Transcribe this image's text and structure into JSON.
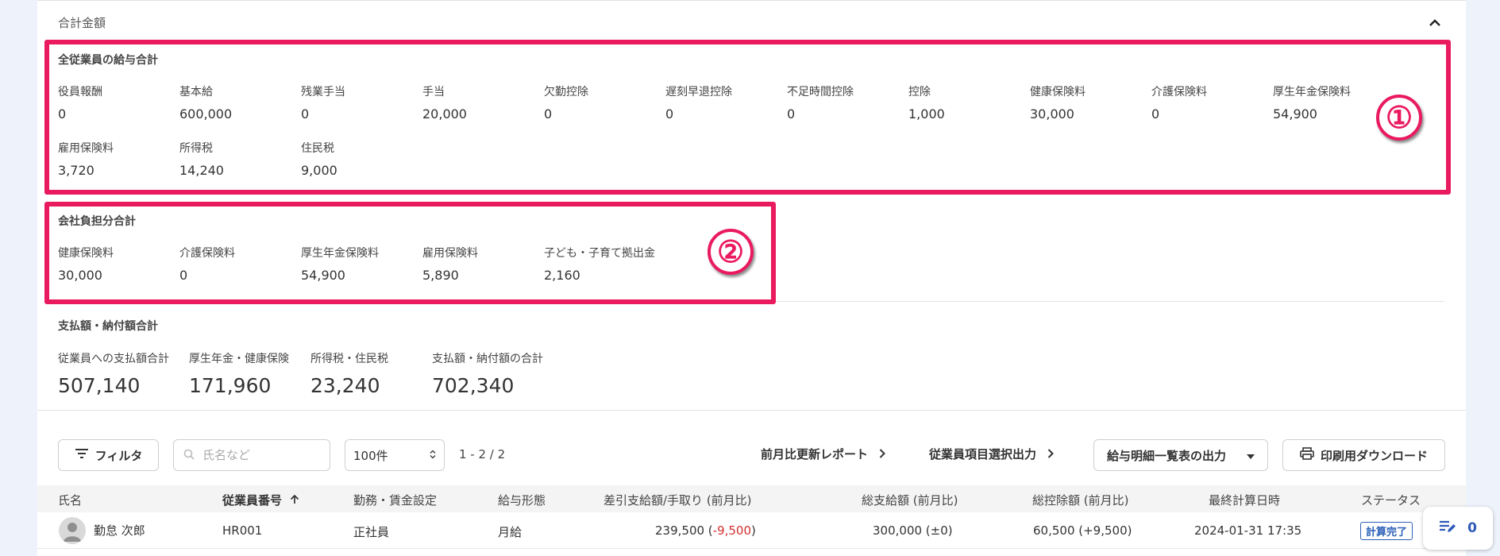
{
  "summary": {
    "header_title": "合計金額",
    "employee_total": {
      "title": "全従業員の給与合計",
      "items": [
        {
          "label": "役員報酬",
          "value": "0"
        },
        {
          "label": "基本給",
          "value": "600,000"
        },
        {
          "label": "残業手当",
          "value": "0"
        },
        {
          "label": "手当",
          "value": "20,000"
        },
        {
          "label": "欠勤控除",
          "value": "0"
        },
        {
          "label": "遅刻早退控除",
          "value": "0"
        },
        {
          "label": "不足時間控除",
          "value": "0"
        },
        {
          "label": "控除",
          "value": "1,000"
        },
        {
          "label": "健康保険料",
          "value": "30,000"
        },
        {
          "label": "介護保険料",
          "value": "0"
        },
        {
          "label": "厚生年金保険料",
          "value": "54,900"
        },
        {
          "label": "雇用保険料",
          "value": "3,720"
        },
        {
          "label": "所得税",
          "value": "14,240"
        },
        {
          "label": "住民税",
          "value": "9,000"
        }
      ]
    },
    "company_total": {
      "title": "会社負担分合計",
      "items": [
        {
          "label": "健康保険料",
          "value": "30,000"
        },
        {
          "label": "介護保険料",
          "value": "0"
        },
        {
          "label": "厚生年金保険料",
          "value": "54,900"
        },
        {
          "label": "雇用保険料",
          "value": "5,890"
        },
        {
          "label": "子ども・子育て拠出金",
          "value": "2,160"
        }
      ]
    },
    "payment_total": {
      "title": "支払額・納付額合計",
      "items": [
        {
          "label": "従業員への支払額合計",
          "value": "507,140"
        },
        {
          "label": "厚生年金・健康保険",
          "value": "171,960"
        },
        {
          "label": "所得税・住民税",
          "value": "23,240"
        },
        {
          "label": "支払額・納付額の合計",
          "value": "702,340"
        }
      ]
    }
  },
  "annotations": {
    "first": "①",
    "second": "②"
  },
  "toolbar": {
    "filter_label": "フィルタ",
    "search_placeholder": "氏名など",
    "per_page": "100件",
    "paging": "1 - 2 / 2",
    "report_link": "前月比更新レポート",
    "item_export_link": "従業員項目選択出力",
    "list_export": "給与明細一覧表の出力",
    "print_download": "印刷用ダウンロード"
  },
  "table": {
    "headers": {
      "name": "氏名",
      "employee_no": "従業員番号",
      "work_setting": "勤務・賃金設定",
      "pay_type": "給与形態",
      "net_pay": "差引支給額/手取り (前月比)",
      "gross_pay": "総支給額 (前月比)",
      "deductions": "総控除額 (前月比)",
      "last_calc": "最終計算日時",
      "status": "ステータス"
    },
    "rows": [
      {
        "name": "勤怠 次郎",
        "employee_no": "HR001",
        "work_setting": "正社員",
        "pay_type": "月給",
        "net_pay": "239,500",
        "net_pay_diff": "-9,500",
        "gross_pay": "300,000 (±0)",
        "deductions": "60,500 (+9,500)",
        "last_calc": "2024-01-31 17:35",
        "status": "計算完了"
      }
    ]
  },
  "float_count": "0",
  "colors": {
    "annotation": "#ea1a5f",
    "link_blue": "#2b5fb8",
    "negative": "#d32f2f"
  }
}
